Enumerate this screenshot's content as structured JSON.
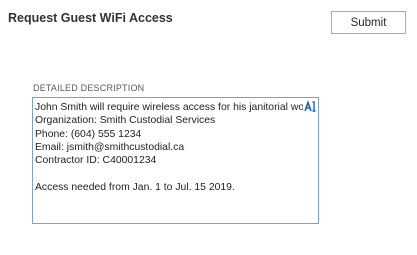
{
  "header": {
    "title": "Request Guest WiFi Access"
  },
  "actions": {
    "submit_label": "Submit"
  },
  "form": {
    "description": {
      "label": "DETAILED DESCRIPTION",
      "value": "John Smith will require wireless access for his janitorial work\nOrganization: Smith Custodial Services\nPhone: (604) 555 1234\nEmail: jsmith@smithcustodial.ca\nContractor ID: C40001234\n\nAccess needed from Jan. 1 to Jul. 15 2019.",
      "badge_icon": "spellcheck-icon"
    }
  },
  "colors": {
    "title_text": "#333333",
    "textarea_border": "#7aa3cc",
    "badge_blue": "#1e5fb8",
    "button_border": "#ababab"
  }
}
